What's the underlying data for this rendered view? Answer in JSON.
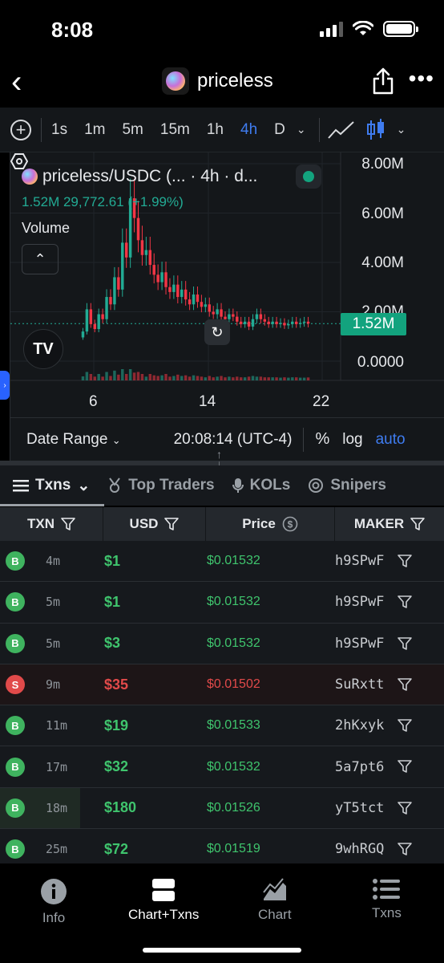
{
  "status_bar": {
    "time": "8:08"
  },
  "header": {
    "title": "priceless"
  },
  "toolbar": {
    "timeframes": [
      "1s",
      "1m",
      "5m",
      "15m",
      "1h",
      "4h",
      "D"
    ],
    "active_timeframe": "4h",
    "accent_color": "#3f7cf0"
  },
  "chart": {
    "legend_pair": "priceless/USDC (... · 4h · d...",
    "legend_values": "1.52M  29,772.61 (+1.99%)",
    "volume_label": "Volume",
    "current_price_label": "1.52M",
    "y_tick_labels": [
      "8.00M",
      "6.00M",
      "4.00M",
      "2.00M",
      "0.0000"
    ],
    "x_tick_labels": [
      "6",
      "14",
      "22"
    ],
    "up_color": "#22ab94",
    "down_color": "#f23645"
  },
  "chart_data": {
    "type": "candlestick",
    "title": "priceless/USDC (... · 4h · d...",
    "ylim": [
      0,
      8000000
    ],
    "y_ticks": [
      8000000,
      6000000,
      4000000,
      2000000,
      0
    ],
    "x_ticks": [
      "6",
      "14",
      "22"
    ],
    "last_price": 1520000,
    "closes": [
      1200000,
      2100000,
      1500000,
      1300000,
      1900000,
      1700000,
      2600000,
      2300000,
      3400000,
      2900000,
      4800000,
      4200000,
      6600000,
      5800000,
      4900000,
      4300000,
      4500000,
      3900000,
      3500000,
      3200000,
      3600000,
      3000000,
      2800000,
      3100000,
      2600000,
      2900000,
      2500000,
      2300000,
      2700000,
      2400000,
      2200000,
      2300000,
      2000000,
      1900000,
      2100000,
      1800000,
      1700000,
      1900000,
      1800000,
      1600000,
      1500000,
      1600000,
      1400000,
      1700000,
      1900000,
      1700000,
      1600000,
      1500000,
      1600000,
      1500000,
      1550000,
      1450000,
      1500000,
      1600000,
      1500000,
      1550000,
      1600000,
      1520000
    ]
  },
  "chart_footer": {
    "date_range": "Date Range",
    "clock": "20:08:14 (UTC-4)",
    "percent": "%",
    "log": "log",
    "auto": "auto"
  },
  "tabs": [
    "Txns",
    "Top Traders",
    "KOLs",
    "Snipers"
  ],
  "table": {
    "headers": [
      "TXN",
      "USD",
      "Price",
      "MAKER"
    ],
    "rows": [
      {
        "type": "B",
        "age": "4m",
        "usd": "$1",
        "price": "$0.01532",
        "maker": "h9SPwF"
      },
      {
        "type": "B",
        "age": "5m",
        "usd": "$1",
        "price": "$0.01532",
        "maker": "h9SPwF"
      },
      {
        "type": "B",
        "age": "5m",
        "usd": "$3",
        "price": "$0.01532",
        "maker": "h9SPwF"
      },
      {
        "type": "S",
        "age": "9m",
        "usd": "$35",
        "price": "$0.01502",
        "maker": "SuRxtt"
      },
      {
        "type": "B",
        "age": "11m",
        "usd": "$19",
        "price": "$0.01533",
        "maker": "2hKxyk"
      },
      {
        "type": "B",
        "age": "17m",
        "usd": "$32",
        "price": "$0.01532",
        "maker": "5a7pt6"
      },
      {
        "type": "B",
        "age": "18m",
        "usd": "$180",
        "price": "$0.01526",
        "maker": "yT5tct"
      },
      {
        "type": "B",
        "age": "25m",
        "usd": "$72",
        "price": "$0.01519",
        "maker": "9whRGQ"
      }
    ]
  },
  "bottom_nav": {
    "items": [
      "Info",
      "Chart+Txns",
      "Chart",
      "Txns"
    ],
    "active": "Chart+Txns"
  }
}
